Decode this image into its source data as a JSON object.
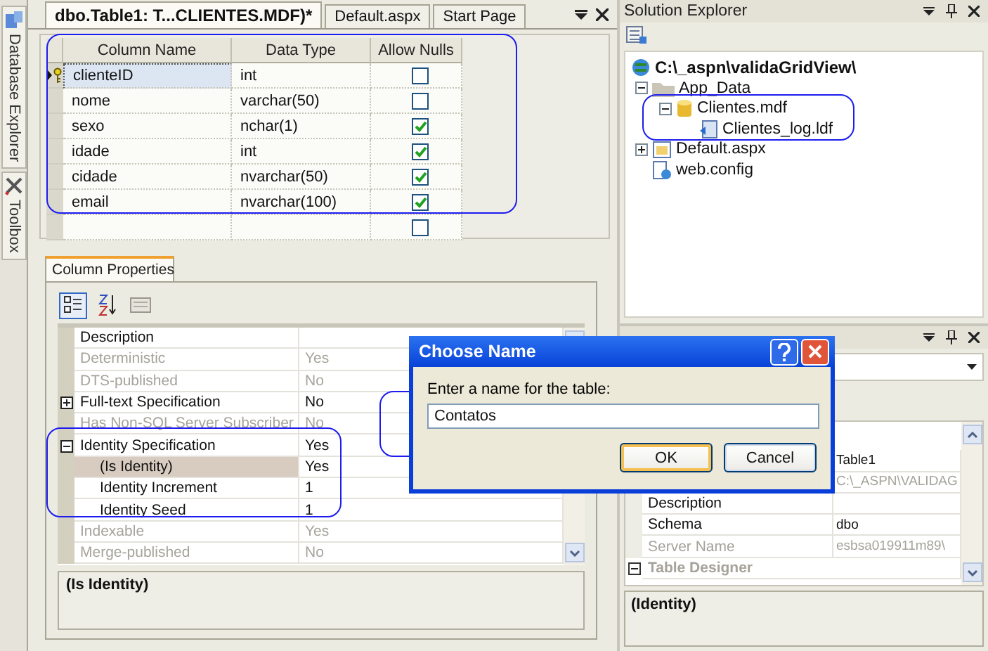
{
  "left_dock": {
    "tabs": [
      {
        "label": "Database Explorer",
        "kind": "database"
      },
      {
        "label": "Toolbox",
        "kind": "tools"
      }
    ]
  },
  "document_tabs": [
    {
      "label": "dbo.Table1: T...CLIENTES.MDF)*",
      "selected": true
    },
    {
      "label": "Default.aspx",
      "selected": false
    },
    {
      "label": "Start Page",
      "selected": false
    }
  ],
  "table_designer": {
    "columns": [
      "Column Name",
      "Data Type",
      "Allow Nulls"
    ],
    "rows": [
      {
        "name": "clienteID",
        "type": "int",
        "allow_nulls": false,
        "primary_key": true,
        "selected": true
      },
      {
        "name": "nome",
        "type": "varchar(50)",
        "allow_nulls": false,
        "primary_key": false,
        "selected": false
      },
      {
        "name": "sexo",
        "type": "nchar(1)",
        "allow_nulls": true,
        "primary_key": false,
        "selected": false
      },
      {
        "name": "idade",
        "type": "int",
        "allow_nulls": true,
        "primary_key": false,
        "selected": false
      },
      {
        "name": "cidade",
        "type": "nvarchar(50)",
        "allow_nulls": true,
        "primary_key": false,
        "selected": false
      },
      {
        "name": "email",
        "type": "nvarchar(100)",
        "allow_nulls": true,
        "primary_key": false,
        "selected": false
      },
      {
        "allow_nulls": false,
        "primary_key": false,
        "selected": false
      }
    ]
  },
  "column_properties": {
    "tab": "Column Properties",
    "rows": [
      {
        "name": "Description",
        "disabled": false,
        "selected": false
      },
      {
        "name": "Deterministic",
        "value": "Yes",
        "disabled": true,
        "selected": false
      },
      {
        "name": "DTS-published",
        "value": "No",
        "disabled": true,
        "selected": false
      },
      {
        "name": "Full-text Specification",
        "value": "No",
        "disabled": false,
        "selected": false,
        "expanded": false
      },
      {
        "name": "Has Non-SQL Server Subscriber",
        "value": "No",
        "disabled": true,
        "selected": false
      },
      {
        "name": "Identity Specification",
        "value": "Yes",
        "disabled": false,
        "selected": false,
        "expanded": true,
        "children": [
          {
            "name": "(Is Identity)",
            "value": "Yes",
            "disabled": false,
            "selected": true
          },
          {
            "name": "Identity Increment",
            "value": "1",
            "disabled": false,
            "selected": false
          },
          {
            "name": "Identity Seed",
            "value": "1",
            "disabled": false,
            "selected": false
          }
        ]
      },
      {
        "name": "Indexable",
        "value": "Yes",
        "disabled": true,
        "selected": false
      },
      {
        "name": "Merge-published",
        "value": "No",
        "disabled": true,
        "selected": false
      }
    ],
    "description": "(Is Identity)"
  },
  "solution_explorer": {
    "title": "Solution Explorer",
    "tree": [
      {
        "label": "C:\\_aspn\\validaGridView\\",
        "kind": "project",
        "children": [
          {
            "label": "App_Data",
            "kind": "folder",
            "expanded": true,
            "children": [
              {
                "label": "Clientes.mdf",
                "kind": "database",
                "expanded": true,
                "children": [
                  {
                    "label": "Clientes_log.ldf",
                    "kind": "log"
                  }
                ]
              }
            ]
          },
          {
            "label": "Default.aspx",
            "kind": "page",
            "expanded": false
          },
          {
            "label": "web.config",
            "kind": "config"
          }
        ]
      }
    ]
  },
  "properties": {
    "rows": [
      {
        "value": "Table1",
        "disabled": false
      },
      {
        "value": "C:\\_ASPN\\VALIDAG",
        "disabled": true
      },
      {
        "name": "Description",
        "disabled": false
      },
      {
        "name": "Schema",
        "value": "dbo",
        "disabled": false
      },
      {
        "name": "Server Name",
        "value": "esbsa019911m89\\",
        "disabled": true
      },
      {
        "kind": "category",
        "name": "Table Designer",
        "expanded": true,
        "disabled": true
      }
    ],
    "description": "(Identity)"
  },
  "dialog": {
    "title": "Choose Name",
    "label": "Enter a name for the table:",
    "value": "Contatos",
    "buttons": [
      {
        "label": "OK",
        "default": true
      },
      {
        "label": "Cancel",
        "default": false
      }
    ]
  }
}
